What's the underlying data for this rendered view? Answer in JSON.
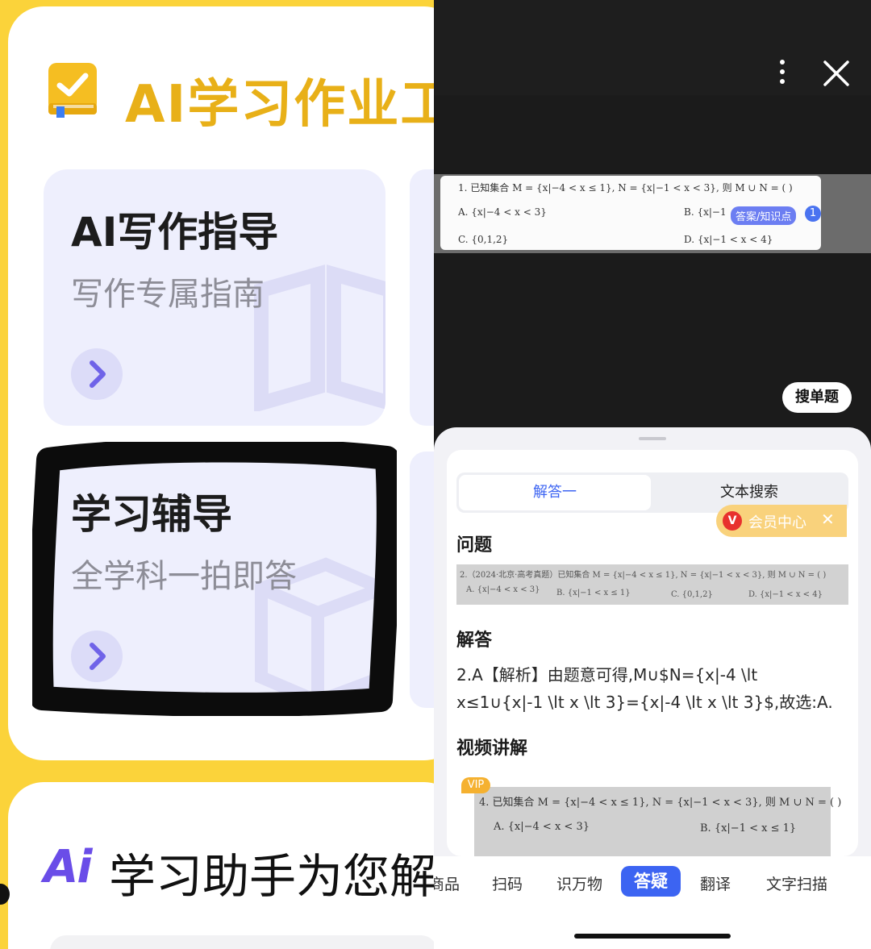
{
  "left": {
    "app_title": "AI学习作业工",
    "cards": [
      {
        "title": "AI写作指导",
        "subtitle": "写作专属指南"
      },
      {
        "title": "学习辅导",
        "subtitle": "全学科一拍即答"
      }
    ],
    "ai_badge": "Ai",
    "assistant_text": "学习助手为您解"
  },
  "right": {
    "photo": {
      "line1": "1. 已知集合 M = {x|−4 < x ≤ 1}, N = {x|−1 < x < 3}, 则 M ∪ N = (    )",
      "optA": "A. {x|−4 < x < 3}",
      "optB": "B. {x|−1",
      "optC": "C. {0,1,2}",
      "optD": "D. {x|−1 < x < 4}",
      "tag": "答案/知识点",
      "count": "1"
    },
    "single_search_button": "搜单题",
    "tabs": [
      "解答一",
      "文本搜索"
    ],
    "question_title": "问题",
    "vip": {
      "label": "会员中心",
      "v": "V"
    },
    "question_image": {
      "line1": "2.（2024·北京·高考真题）已知集合 M = {x|−4 < x ≤ 1}, N = {x|−1 < x < 3}, 则 M ∪ N = (    )",
      "optA": "A. {x|−4 < x < 3}",
      "optB": "B. {x|−1 < x ≤ 1}",
      "optC": "C. {0,1,2}",
      "optD": "D. {x|−1 < x < 4}"
    },
    "answer_title": "解答",
    "answer_text": "2.A【解析】由题意可得,M∪$N={x|-4 \\lt x≤1∪{x|-1 \\lt x \\lt 3}={x|-4 \\lt x \\lt 3}$,故选:A.",
    "video_title": "视频讲解",
    "video": {
      "badge": "VIP",
      "line1": "4. 已知集合 M = {x|−4 < x ≤ 1}, N = {x|−1 < x < 3}, 则 M ∪ N = (    )",
      "optA": "A. {x|−4 < x < 3}",
      "optB": "B. {x|−1 < x ≤ 1}"
    },
    "nav": [
      "商品",
      "扫码",
      "识万物",
      "答疑",
      "翻译",
      "文字扫描"
    ]
  }
}
